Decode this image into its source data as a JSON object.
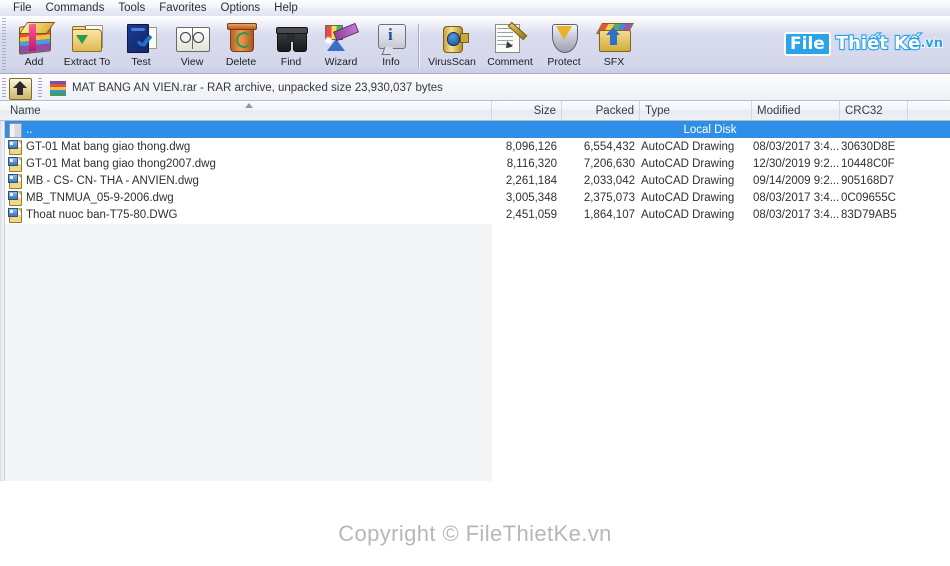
{
  "menu": {
    "items": [
      {
        "label": "File"
      },
      {
        "label": "Commands"
      },
      {
        "label": "Tools"
      },
      {
        "label": "Favorites"
      },
      {
        "label": "Options"
      },
      {
        "label": "Help"
      }
    ]
  },
  "toolbar": {
    "buttons": [
      {
        "label": "Add",
        "icon": "archive-add-icon"
      },
      {
        "label": "Extract To",
        "icon": "folder-extract-icon"
      },
      {
        "label": "Test",
        "icon": "test-check-icon"
      },
      {
        "label": "View",
        "icon": "open-book-icon"
      },
      {
        "label": "Delete",
        "icon": "recycle-bin-icon"
      },
      {
        "label": "Find",
        "icon": "binoculars-icon"
      },
      {
        "label": "Wizard",
        "icon": "magic-wand-icon"
      },
      {
        "label": "Info",
        "icon": "info-balloon-icon"
      },
      {
        "label": "VirusScan",
        "icon": "virus-spray-icon"
      },
      {
        "label": "Comment",
        "icon": "note-pen-icon"
      },
      {
        "label": "Protect",
        "icon": "shield-icon"
      },
      {
        "label": "SFX",
        "icon": "sfx-box-icon"
      }
    ]
  },
  "address_bar": {
    "up_button": "up-one-level-button",
    "archive_icon": "rar-archive-icon",
    "text": "MAT BANG AN VIEN.rar - RAR archive, unpacked size 23,930,037 bytes"
  },
  "file_list": {
    "columns": [
      {
        "key": "name",
        "label": "Name",
        "align": "left"
      },
      {
        "key": "size",
        "label": "Size",
        "align": "right"
      },
      {
        "key": "packed",
        "label": "Packed",
        "align": "right"
      },
      {
        "key": "type",
        "label": "Type",
        "align": "left"
      },
      {
        "key": "modified",
        "label": "Modified",
        "align": "left"
      },
      {
        "key": "crc32",
        "label": "CRC32",
        "align": "left"
      }
    ],
    "sort_indicator": "ascending",
    "parent_row": {
      "name": "..",
      "selected": true,
      "status_text": "Local Disk",
      "icon": "parent-folder-icon"
    },
    "rows": [
      {
        "name": "GT-01 Mat bang giao thong.dwg",
        "size": "8,096,126",
        "packed": "6,554,432",
        "type": "AutoCAD Drawing",
        "modified": "08/03/2017 3:4...",
        "crc32": "30630D8E",
        "icon": "autocad-file-icon"
      },
      {
        "name": "GT-01 Mat bang giao thong2007.dwg",
        "size": "8,116,320",
        "packed": "7,206,630",
        "type": "AutoCAD Drawing",
        "modified": "12/30/2019 9:2...",
        "crc32": "10448C0F",
        "icon": "autocad-file-icon"
      },
      {
        "name": "MB - CS- CN- THA - ANVIEN.dwg",
        "size": "2,261,184",
        "packed": "2,033,042",
        "type": "AutoCAD Drawing",
        "modified": "09/14/2009 9:2...",
        "crc32": "905168D7",
        "icon": "autocad-file-icon"
      },
      {
        "name": "MB_TNMUA_05-9-2006.dwg",
        "size": "3,005,348",
        "packed": "2,375,073",
        "type": "AutoCAD Drawing",
        "modified": "08/03/2017 3:4...",
        "crc32": "0C09655C",
        "icon": "autocad-file-icon"
      },
      {
        "name": "Thoat nuoc ban-T75-80.DWG",
        "size": "2,451,059",
        "packed": "1,864,107",
        "type": "AutoCAD Drawing",
        "modified": "08/03/2017 3:4...",
        "crc32": "83D79AB5",
        "icon": "autocad-file-icon"
      }
    ]
  },
  "watermarks": {
    "logo": {
      "part1": "File",
      "part2": "Thiết Kế",
      "part3": ".vn"
    },
    "copyright": "Copyright © FileThietKe.vn"
  },
  "colors": {
    "selection": "#2f8ee8",
    "brand": "#2aa3e8",
    "toolbar": "#d7daec"
  }
}
